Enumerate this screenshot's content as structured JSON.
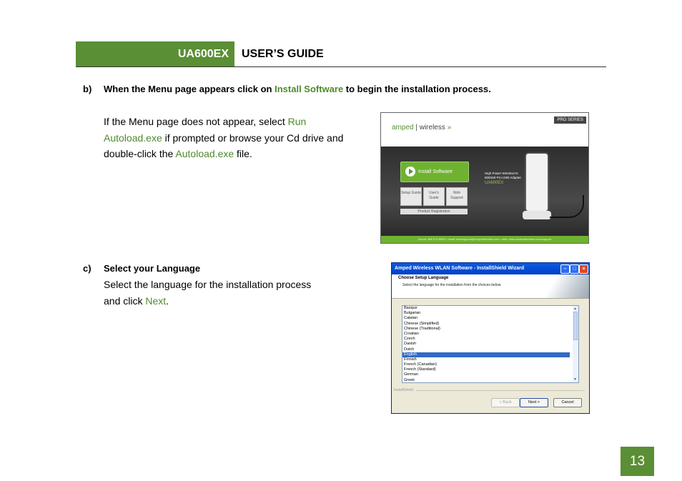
{
  "header": {
    "model": "UA600EX",
    "title": "USER’S GUIDE"
  },
  "step_b": {
    "marker": "b)",
    "text_before": "When the Menu page appears click on ",
    "highlight": "Install Software",
    "text_after": " to begin the installation process.",
    "para_1": "If the Menu page does not appear, select ",
    "para_link_1": "Run Autoload.exe",
    "para_2": " if prompted or browse your Cd drive and double-click the ",
    "para_link_2": "Autoload.exe",
    "para_3": " file."
  },
  "step_c": {
    "marker": "c)",
    "heading": "Select your Language",
    "line_1": "Select the language for the installation process",
    "line_2_before": "and click ",
    "line_2_link": "Next",
    "line_2_after": "."
  },
  "menu_screenshot": {
    "logo_left": "amped",
    "logo_right": "wireless",
    "pro_series": "PRO SERIES",
    "install_label": "Install Software",
    "buttons": [
      "Setup Guide",
      "User's Guide",
      "Web Support"
    ],
    "registration": "Product Registration",
    "product_line_1": "High Power Wireless-N",
    "product_line_2": "600mW Pro USB Adapter",
    "model": "UA600EX",
    "footer": "phone: 888 573-8820  •  email: techsupport@ampedwireless.com  •  web: www.ampedwireless.com/support"
  },
  "wizard_screenshot": {
    "title": "Amped Wireless WLAN Software - InstallShield Wizard",
    "heading": "Choose Setup Language",
    "subheading": "Select the language for the installation from the choices below.",
    "languages": [
      "Basque",
      "Bulgarian",
      "Catalan",
      "Chinese (Simplified)",
      "Chinese (Traditional)",
      "Croatian",
      "Czech",
      "Danish",
      "Dutch",
      "English",
      "Finnish",
      "French (Canadian)",
      "French (Standard)",
      "German",
      "Greek"
    ],
    "selected_language": "English",
    "brand": "InstallShield",
    "back_label": "< Back",
    "next_label": "Next >",
    "cancel_label": "Cancel"
  },
  "page_number": "13",
  "colors": {
    "accent_green": "#5a8f35",
    "link_green": "#4f8a2b"
  }
}
